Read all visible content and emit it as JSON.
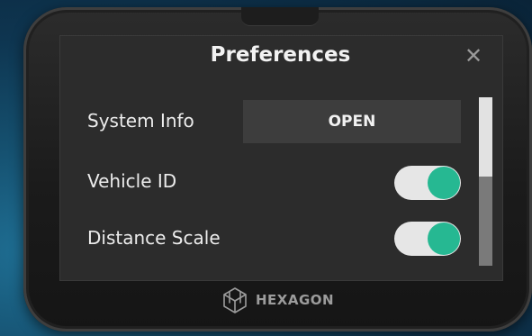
{
  "dialog": {
    "title": "Preferences",
    "close_icon": "close-icon"
  },
  "settings": {
    "system_info": {
      "label": "System Info",
      "button_label": "OPEN"
    },
    "vehicle_id": {
      "label": "Vehicle ID",
      "enabled": true
    },
    "distance_scale": {
      "label": "Distance Scale",
      "enabled": true
    }
  },
  "device": {
    "brand": "HEXAGON",
    "logo_icon": "hexagon-logo-icon"
  },
  "colors": {
    "toggle_on": "#26b892",
    "toggle_track": "#e6e6e6",
    "panel_bg": "#2c2c2c",
    "button_bg": "#3d3d3d"
  }
}
